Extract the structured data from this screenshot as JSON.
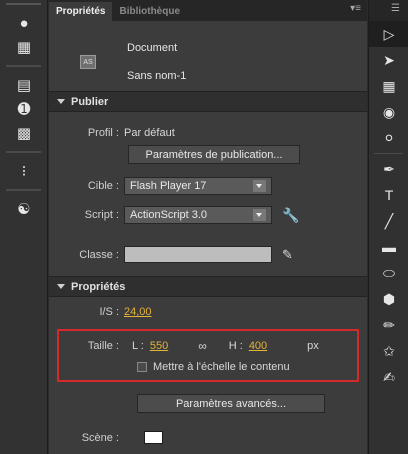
{
  "left_dock": {
    "icons": [
      "components-icon",
      "grid-icon",
      "align-icon",
      "info-icon",
      "transform-icon",
      "motion-icon",
      "swatches-icon"
    ]
  },
  "tabs": {
    "properties": "Propriétés",
    "library": "Bibliothèque",
    "menu_glyph": "▾≡"
  },
  "document": {
    "type": "Document",
    "name": "Sans nom-1",
    "icon_text": "AS"
  },
  "publish": {
    "header": "Publier",
    "profile_label": "Profil :",
    "profile_value": "Par défaut",
    "publish_settings_button": "Paramètres de publication...",
    "target_label": "Cible :",
    "target_value": "Flash Player 17",
    "script_label": "Script :",
    "script_value": "ActionScript 3.0",
    "class_label": "Classe :"
  },
  "properties": {
    "header": "Propriétés",
    "fps_label": "I/S :",
    "fps_value": "24,00",
    "size_label": "Taille :",
    "width_label": "L :",
    "width_value": "550",
    "height_label": "H :",
    "height_value": "400",
    "unit": "px",
    "scale_checkbox_label": "Mettre à l'échelle le contenu",
    "advanced_button": "Paramètres avancés...",
    "stage_label": "Scène :",
    "stage_color": "#ffffff"
  },
  "colors": {
    "highlight": "#d42a2a",
    "hot_value": "#e3b33a"
  },
  "right_tools": [
    "selection-tool",
    "subselection-tool",
    "free-transform-tool",
    "3d-rotation-tool",
    "lasso-tool",
    "pen-tool",
    "text-tool",
    "line-tool",
    "rectangle-tool",
    "oval-tool",
    "polystar-tool",
    "pencil-tool",
    "brush-tool",
    "paint-brush-tool"
  ]
}
